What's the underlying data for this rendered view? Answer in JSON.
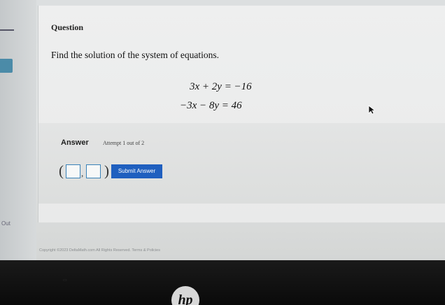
{
  "question": {
    "title": "Question",
    "prompt": "Find the solution of the system of equations.",
    "equations": [
      "3x + 2y = −16",
      "−3x − 8y = 46"
    ]
  },
  "answer": {
    "label": "Answer",
    "attempt": "Attempt 1 out of 2",
    "comma": ",",
    "submit_label": "Submit Answer"
  },
  "sidebar": {
    "out_label": "Out"
  },
  "footer": {
    "copyright": "Copyright ©2023 DeltaMath.com All Rights Reserved. Terms & Policies"
  },
  "bezel": {
    "logo": "hp"
  },
  "colors": {
    "submit_bg": "#1f5fbf",
    "input_border": "#3a82b8",
    "sidebar_tab": "#4b8ba8"
  },
  "icons": [
    "mouse-cursor-icon",
    "hp-logo-icon"
  ]
}
